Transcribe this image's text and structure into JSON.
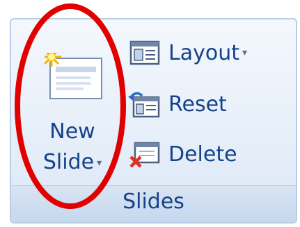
{
  "group": {
    "label": "Slides"
  },
  "new_slide": {
    "line1": "New",
    "line2": "Slide",
    "caret": "▾"
  },
  "buttons": {
    "layout": {
      "label": "Layout",
      "caret": "▾"
    },
    "reset": {
      "label": "Reset"
    },
    "delete": {
      "label": "Delete"
    }
  },
  "colors": {
    "text": "#15428b",
    "panel_border": "#b9cde6",
    "annotation": "#e00000"
  },
  "icons": [
    "new-slide-icon",
    "layout-icon",
    "reset-icon",
    "delete-icon"
  ]
}
